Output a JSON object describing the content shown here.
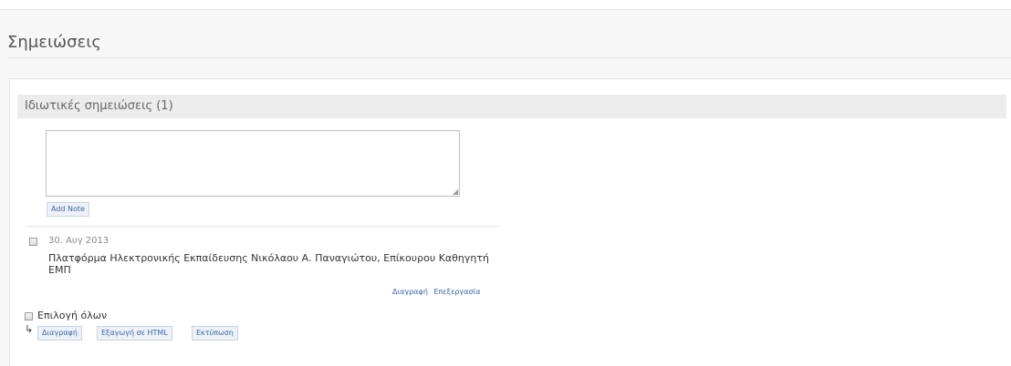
{
  "page": {
    "title": "Σημειώσεις"
  },
  "section": {
    "title": "Ιδιωτικές σημειώσεις (1)"
  },
  "editor": {
    "value": "",
    "add_label": "Add Note"
  },
  "notes": [
    {
      "date": "30. Αυγ 2013",
      "text": "Πλατφόρμα Ηλεκτρονικής Εκπαίδευσης Νικόλαου Α. Παναγιώτου, Επίκουρου Καθηγητή ΕΜΠ",
      "delete_label": "Διαγραφή",
      "edit_label": "Επεξεργασία"
    }
  ],
  "bulk": {
    "select_all_label": "Επιλογή όλων",
    "delete_label": "Διαγραφή",
    "export_label": "Εξαγωγή σε HTML",
    "print_label": "Εκτύπωση"
  }
}
